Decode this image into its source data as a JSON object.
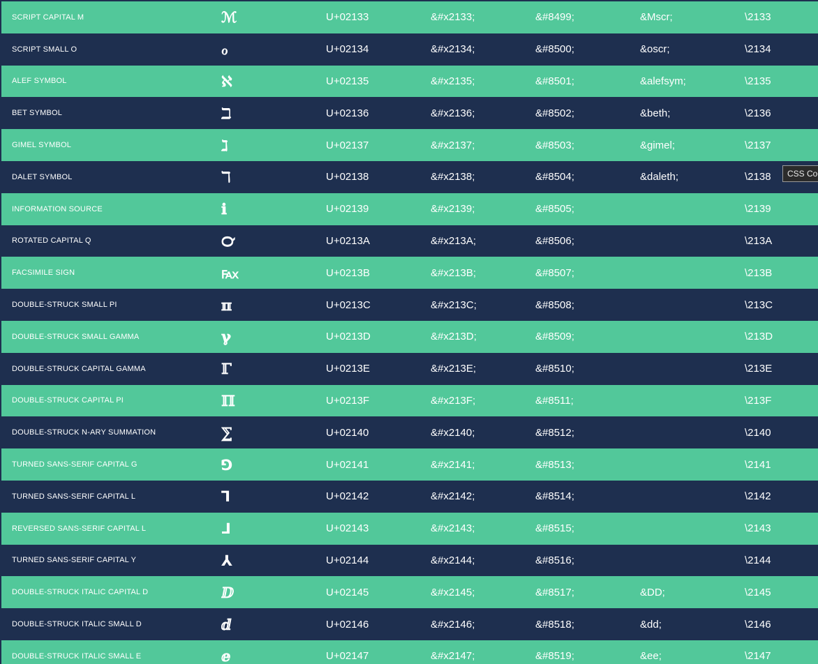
{
  "rows": [
    {
      "name": "SCRIPT CAPITAL M",
      "glyph": "ℳ",
      "code": "U+02133",
      "hex": "&#x2133;",
      "dec": "&#8499;",
      "entity": "&Mscr;",
      "css": "\\2133"
    },
    {
      "name": "SCRIPT SMALL O",
      "glyph": "ℴ",
      "code": "U+02134",
      "hex": "&#x2134;",
      "dec": "&#8500;",
      "entity": "&oscr;",
      "css": "\\2134"
    },
    {
      "name": "ALEF SYMBOL",
      "glyph": "ℵ",
      "code": "U+02135",
      "hex": "&#x2135;",
      "dec": "&#8501;",
      "entity": "&alefsym;",
      "css": "\\2135"
    },
    {
      "name": "BET SYMBOL",
      "glyph": "ℶ",
      "code": "U+02136",
      "hex": "&#x2136;",
      "dec": "&#8502;",
      "entity": "&beth;",
      "css": "\\2136"
    },
    {
      "name": "GIMEL SYMBOL",
      "glyph": "ℷ",
      "code": "U+02137",
      "hex": "&#x2137;",
      "dec": "&#8503;",
      "entity": "&gimel;",
      "css": "\\2137"
    },
    {
      "name": "DALET SYMBOL",
      "glyph": "ℸ",
      "code": "U+02138",
      "hex": "&#x2138;",
      "dec": "&#8504;",
      "entity": "&daleth;",
      "css": "\\2138"
    },
    {
      "name": "INFORMATION SOURCE",
      "glyph": "ℹ",
      "code": "U+02139",
      "hex": "&#x2139;",
      "dec": "&#8505;",
      "entity": "",
      "css": "\\2139"
    },
    {
      "name": "ROTATED CAPITAL Q",
      "glyph": "℺",
      "code": "U+0213A",
      "hex": "&#x213A;",
      "dec": "&#8506;",
      "entity": "",
      "css": "\\213A"
    },
    {
      "name": "FACSIMILE SIGN",
      "glyph": "℻",
      "code": "U+0213B",
      "hex": "&#x213B;",
      "dec": "&#8507;",
      "entity": "",
      "css": "\\213B"
    },
    {
      "name": "DOUBLE-STRUCK SMALL PI",
      "glyph": "ℼ",
      "code": "U+0213C",
      "hex": "&#x213C;",
      "dec": "&#8508;",
      "entity": "",
      "css": "\\213C"
    },
    {
      "name": "DOUBLE-STRUCK SMALL GAMMA",
      "glyph": "ℽ",
      "code": "U+0213D",
      "hex": "&#x213D;",
      "dec": "&#8509;",
      "entity": "",
      "css": "\\213D"
    },
    {
      "name": "DOUBLE-STRUCK CAPITAL GAMMA",
      "glyph": "ℾ",
      "code": "U+0213E",
      "hex": "&#x213E;",
      "dec": "&#8510;",
      "entity": "",
      "css": "\\213E"
    },
    {
      "name": "DOUBLE-STRUCK CAPITAL PI",
      "glyph": "ℿ",
      "code": "U+0213F",
      "hex": "&#x213F;",
      "dec": "&#8511;",
      "entity": "",
      "css": "\\213F"
    },
    {
      "name": "DOUBLE-STRUCK N-ARY SUMMATION",
      "glyph": "⅀",
      "code": "U+02140",
      "hex": "&#x2140;",
      "dec": "&#8512;",
      "entity": "",
      "css": "\\2140"
    },
    {
      "name": "TURNED SANS-SERIF CAPITAL G",
      "glyph": "⅁",
      "code": "U+02141",
      "hex": "&#x2141;",
      "dec": "&#8513;",
      "entity": "",
      "css": "\\2141"
    },
    {
      "name": "TURNED SANS-SERIF CAPITAL L",
      "glyph": "⅂",
      "code": "U+02142",
      "hex": "&#x2142;",
      "dec": "&#8514;",
      "entity": "",
      "css": "\\2142"
    },
    {
      "name": "REVERSED SANS-SERIF CAPITAL L",
      "glyph": "⅃",
      "code": "U+02143",
      "hex": "&#x2143;",
      "dec": "&#8515;",
      "entity": "",
      "css": "\\2143"
    },
    {
      "name": "TURNED SANS-SERIF CAPITAL Y",
      "glyph": "⅄",
      "code": "U+02144",
      "hex": "&#x2144;",
      "dec": "&#8516;",
      "entity": "",
      "css": "\\2144"
    },
    {
      "name": "DOUBLE-STRUCK ITALIC CAPITAL D",
      "glyph": "ⅅ",
      "code": "U+02145",
      "hex": "&#x2145;",
      "dec": "&#8517;",
      "entity": "&DD;",
      "css": "\\2145"
    },
    {
      "name": "DOUBLE-STRUCK ITALIC SMALL D",
      "glyph": "ⅆ",
      "code": "U+02146",
      "hex": "&#x2146;",
      "dec": "&#8518;",
      "entity": "&dd;",
      "css": "\\2146"
    },
    {
      "name": "DOUBLE-STRUCK ITALIC SMALL E",
      "glyph": "ⅇ",
      "code": "U+02147",
      "hex": "&#x2147;",
      "dec": "&#8519;",
      "entity": "&ee;",
      "css": "\\2147"
    }
  ],
  "tooltip": "CSS Code",
  "colors": {
    "row_green": "#52c89a",
    "row_navy": "#1e2f4f",
    "text": "#ffffff"
  }
}
